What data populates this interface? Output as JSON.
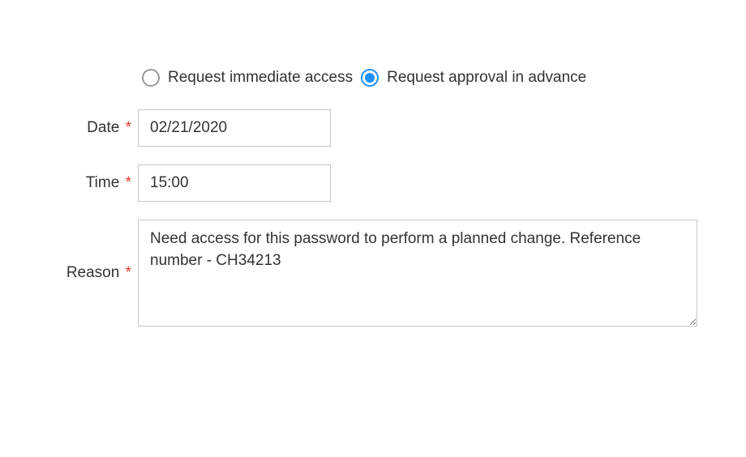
{
  "radio": {
    "immediate": {
      "label": "Request immediate access",
      "checked": false
    },
    "advance": {
      "label": "Request approval in advance",
      "checked": true
    }
  },
  "fields": {
    "date": {
      "label": "Date",
      "required_mark": "*",
      "value": "02/21/2020"
    },
    "time": {
      "label": "Time",
      "required_mark": "*",
      "value": "15:00"
    },
    "reason": {
      "label": "Reason",
      "required_mark": "*",
      "value": "Need access for this password to perform a planned change. Reference number - CH34213"
    }
  }
}
